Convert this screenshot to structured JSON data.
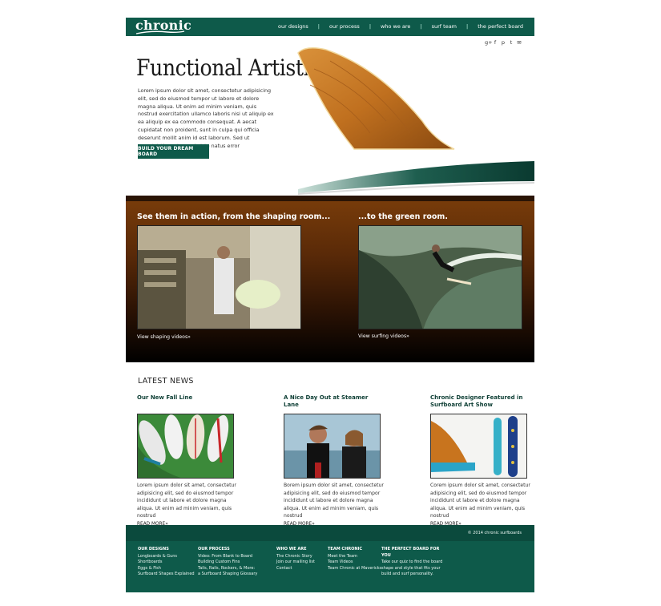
{
  "brand": {
    "logo_text": "chronic",
    "accent": "#0e5a4a"
  },
  "nav": {
    "items": [
      "our designs",
      "our process",
      "who we are",
      "surf team",
      "the perfect board"
    ],
    "separator": "|"
  },
  "social": {
    "icons": [
      "google-plus-icon",
      "facebook-icon",
      "pinterest-icon",
      "twitter-icon",
      "email-icon"
    ],
    "glyphs": [
      "g+",
      "f",
      "p",
      "t",
      "✉"
    ]
  },
  "hero": {
    "title": "Functional Artistry",
    "body": "Lorem ipsum dolor sit amet, consectetur adipisicing elit, sed do eiusmod tempor ut labore et dolore magna aliqua. Ut enim ad minim veniam, quis nostrud exercitation ullamco laboris nisi ut aliquip ex ea aliquip ex ea commodo consequat. A aecat cupidatat non proident, sunt in culpa qui officia deserunt mollit anim id est laborum. Sed ut perspiciatis unde omnis iste natus error",
    "button": "BUILD YOUR DREAM BOARD"
  },
  "videos": {
    "left_heading": "See them in action, from the shaping room...",
    "right_heading": "...to the green room.",
    "left_link": "View shaping videos»",
    "right_link": "View surfing videos»"
  },
  "news": {
    "heading": "LATEST NEWS",
    "items": [
      {
        "title": "Our New Fall Line",
        "body": "Lorem ipsum dolor sit amet, consectetur adipisicing elit, sed do eiusmod tempor incididunt ut labore et dolore magna aliqua. Ut enim ad minim veniam, quis nostrud",
        "more": "READ MORE»"
      },
      {
        "title": "A Nice Day Out at Steamer Lane",
        "body": "Borem ipsum dolor sit amet, consectetur adipisicing elit, sed do eiusmod tempor incididunt ut labore et dolore magna aliqua. Ut enim ad minim veniam, quis nostrud",
        "more": "READ MORE»"
      },
      {
        "title": "Chronic Designer Featured in Surfboard Art Show",
        "body": "Corem ipsum dolor sit amet, consectetur adipisicing elit, sed do eiusmod tempor incididunt ut labore et dolore magna aliqua. Ut enim ad minim veniam, quis nostrud",
        "more": "READ MORE»"
      }
    ]
  },
  "footer": {
    "copyright": "© 2014 chronic surfboards",
    "columns": [
      {
        "heading": "OUR DESIGNS",
        "links": [
          "Longboards & Guns",
          "Shortboards",
          "Eggs & Fish",
          "Surfboard Shapes Explained"
        ]
      },
      {
        "heading": "OUR PROCESS",
        "links": [
          "Video: From Blank to Board",
          "Building Custom Fins",
          "Tails, Rails, Rockers, & More:",
          "a Surfboard Shaping Glossary"
        ]
      },
      {
        "heading": "WHO WE ARE",
        "links": [
          "The Chronic Story",
          "Join our mailing list",
          "Contact"
        ]
      },
      {
        "heading": "TEAM CHRONIC",
        "links": [
          "Meet the Team",
          "Team Videos",
          "Team Chronic at Mavericks"
        ]
      },
      {
        "heading": "THE PERFECT BOARD FOR YOU",
        "links": [
          "Take our quiz to find the board shape and style that fits your build and surf personality."
        ]
      }
    ]
  }
}
